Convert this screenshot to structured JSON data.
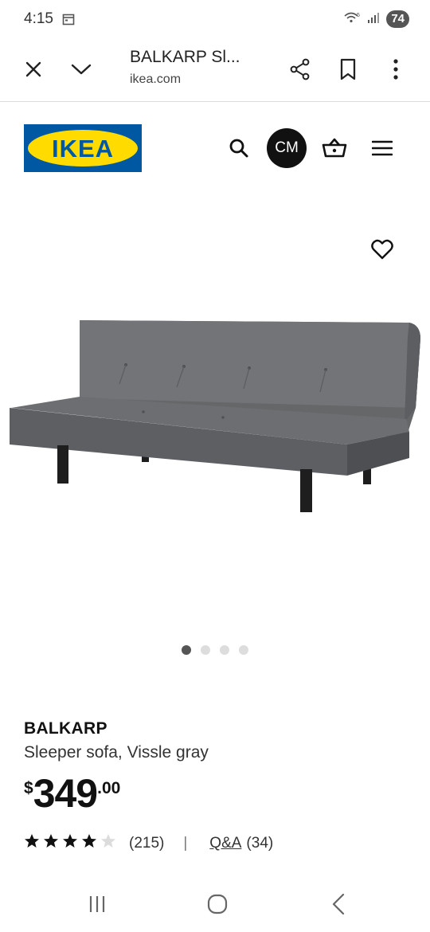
{
  "status_bar": {
    "time": "4:15",
    "battery": "74",
    "icons": [
      "calendar-icon",
      "wifi-icon",
      "signal-icon",
      "battery-icon"
    ]
  },
  "browser": {
    "title": "BALKARP Sl...",
    "url": "ikea.com",
    "icons": [
      "close-icon",
      "chevron-down-icon",
      "share-icon",
      "bookmark-icon",
      "more-vertical-icon"
    ]
  },
  "header": {
    "logo_text": "IKEA",
    "avatar_initials": "CM",
    "icons": [
      "search-icon",
      "basket-icon",
      "menu-icon"
    ]
  },
  "gallery": {
    "slide_count": 4,
    "active_index": 0
  },
  "product": {
    "name": "BALKARP",
    "description": "Sleeper sofa, Vissle gray",
    "price_currency": "$",
    "price_integer": "349",
    "price_decimal": ".00",
    "rating": 4,
    "rating_max": 5,
    "review_count": "(215)",
    "separator": "|",
    "qa_label": "Q&A",
    "qa_count": "(34)"
  },
  "colors": {
    "ikea_blue": "#0058a3",
    "ikea_yellow": "#ffdb00",
    "sofa_gray": "#6e7074"
  }
}
